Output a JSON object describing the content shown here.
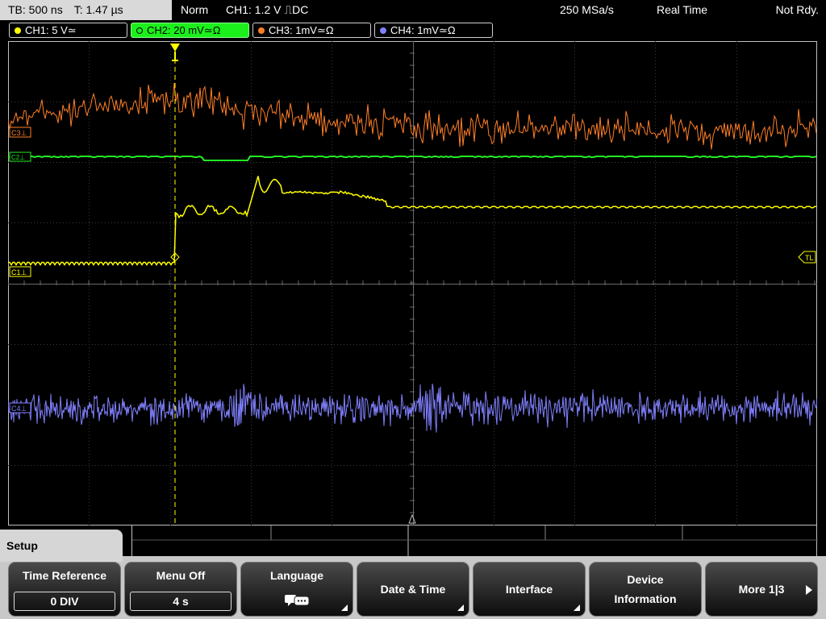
{
  "status": {
    "timebase": "TB: 500 ns",
    "trigger_time": "T: 1.47 µs",
    "mode": "Norm",
    "trigger_info": "CH1: 1.2 V ⎍DC",
    "sample_rate": "250 MSa/s",
    "acq_mode": "Real Time",
    "run_state": "Not Rdy."
  },
  "channels": [
    {
      "label": "CH1: 5 V≃",
      "color": "#ffff00",
      "active": false
    },
    {
      "label": "CH2: 20 mV≃Ω",
      "color": "#22ee22",
      "active": true
    },
    {
      "label": "CH3: 1mV≃Ω",
      "color": "#ff7f27",
      "active": false
    },
    {
      "label": "CH4: 1mV≃Ω",
      "color": "#8080ff",
      "active": false
    }
  ],
  "markers": {
    "ch3_ground": "C3⊥",
    "ch2_ground": "C2⊥",
    "ch1_ground": "C1⊥",
    "ch4_ground": "C4⊥",
    "trigger_level": "TL"
  },
  "menu": {
    "tab": "Setup",
    "keys": [
      {
        "title": "Time Reference",
        "value": "0 DIV"
      },
      {
        "title": "Menu Off",
        "value": "4 s"
      },
      {
        "title": "Language",
        "icon": "speech-bubbles-icon"
      },
      {
        "title": "Date & Time"
      },
      {
        "title": "Interface"
      },
      {
        "title": "Device\nInformation"
      },
      {
        "title": "More 1|3"
      }
    ]
  }
}
